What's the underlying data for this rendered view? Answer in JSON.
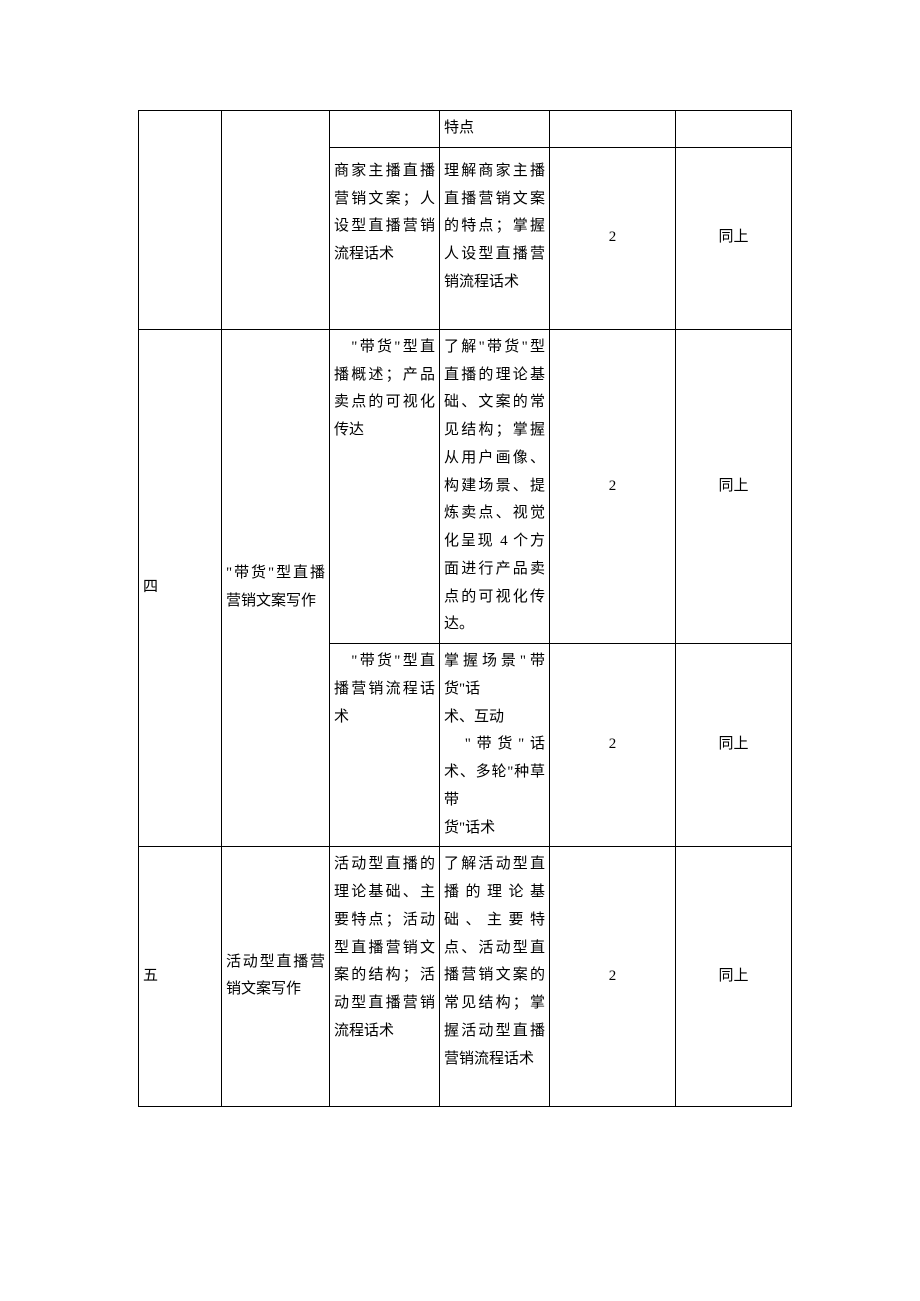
{
  "rows": [
    {
      "col3": "",
      "col4": "特点",
      "col5": "",
      "col6": ""
    },
    {
      "col3": "商家主播直播营销文案；人设型直播营销流程话术",
      "col4": "理解商家主播直播营销文案的特点；掌握人设型直播营销流程话术",
      "col5": "2",
      "col6": "同上"
    },
    {
      "col1": "四",
      "col2": "\"带货\"型直播营销文案写作",
      "sub": [
        {
          "col3": "　\"带货\"型直播概述；产品卖点的可视化传达",
          "col4": "了解\"带货\"型直播的理论基础、文案的常见结构；掌握从用户画像、构建场景、提炼卖点、视觉化呈现 4 个方面进行产品卖点的可视化传达。",
          "col5": "2",
          "col6": "同上"
        },
        {
          "col3": "　\"带货\"型直播营销流程话术",
          "col4": "掌握场景\"带　货\"话\n术、互动\n　\"带货\"话术、多轮\"种草带\n货\"话术",
          "col5": "2",
          "col6": "同上"
        }
      ]
    },
    {
      "col1": "五",
      "col2": "活动型直播营销文案写作",
      "col3": "活动型直播的理论基础、主要特点；活动型直播营销文案的结构；活动型直播营销流程话术",
      "col4": "了解活动型直播的理论基础、主要特点、活动型直播营销文案的常见结构；掌握活动型直播营销流程话术",
      "col5": "2",
      "col6": "同上"
    }
  ]
}
